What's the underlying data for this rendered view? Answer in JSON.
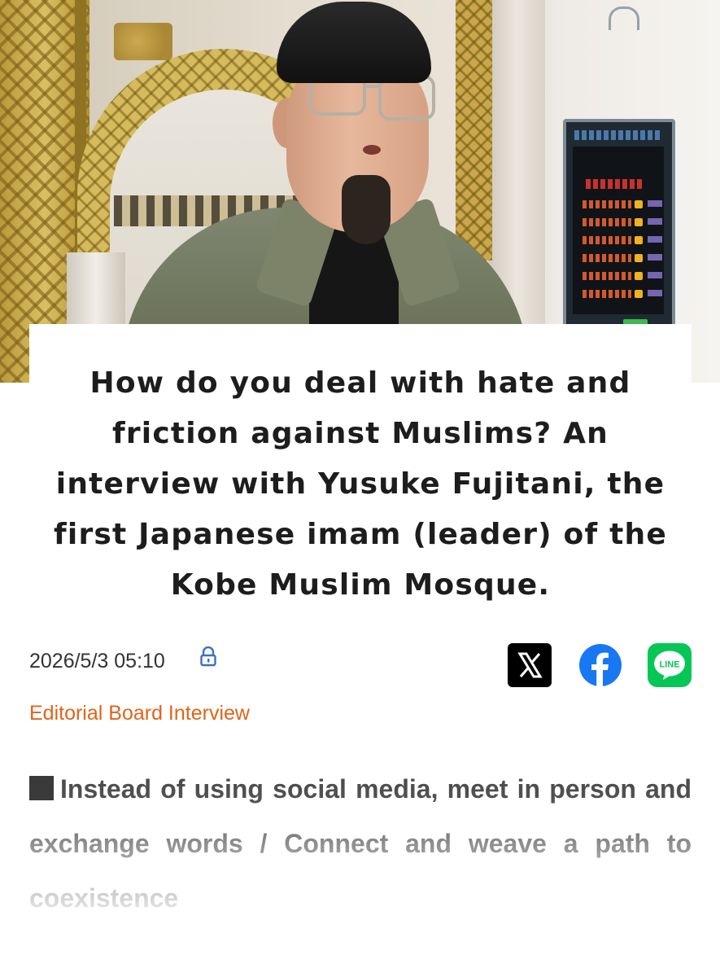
{
  "article": {
    "headline": "How do you deal with hate and friction against Muslims? An interview with Yusuke Fujitani, the first Japanese imam (leader) of the Kobe Muslim Mosque.",
    "date": "2026/5/3 05:10",
    "category": "Editorial Board Interview",
    "lead_text": "Instead of using social media, meet in person and exchange words / Connect and weave a path to coexistence"
  },
  "share": {
    "items": [
      {
        "name": "x",
        "icon": "x-logo-icon"
      },
      {
        "name": "facebook",
        "icon": "facebook-logo-icon"
      },
      {
        "name": "line",
        "icon": "line-logo-icon",
        "label": "LINE"
      }
    ]
  },
  "icons": {
    "lock": "lock-icon",
    "lead_bullet": "square-bullet-icon"
  },
  "colors": {
    "category": "#e0641a",
    "x_bg": "#000000",
    "facebook": "#1877f2",
    "line": "#06c755",
    "lock": "#3a6fc4"
  }
}
